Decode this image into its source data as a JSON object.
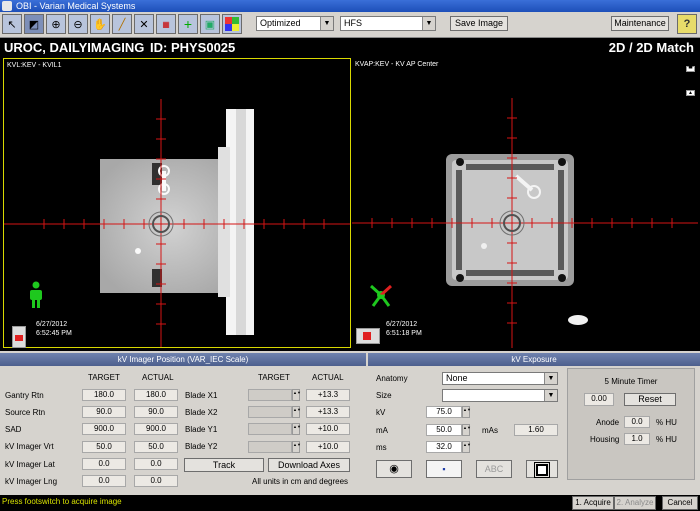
{
  "window": {
    "title": "OBI - Varian Medical Systems"
  },
  "toolbar": {
    "tools": [
      "select-tool",
      "window-level-tool",
      "zoom-in-tool",
      "zoom-out-tool",
      "pan-tool",
      "measure-tool",
      "match-tool",
      "spyglass-tool",
      "add-marker-tool",
      "blend-tool",
      "color-tool"
    ],
    "view_mode": "Optimized",
    "orientation": "HFS",
    "save_image_label": "Save Image",
    "maintenance_label": "Maintenance",
    "help_label": "?"
  },
  "header": {
    "patient": "UROC, DAILYIMAGING",
    "id_label": "ID: PHYS0025",
    "mode": "2D / 2D Match"
  },
  "viewers": {
    "left": {
      "label": "KVL:KEV - KVIL1",
      "date": "6/27/2012",
      "time": "6:52:45 PM"
    },
    "right": {
      "label": "KVAP:KEV - KV AP Center",
      "date": "6/27/2012",
      "time": "6:51:18 PM"
    }
  },
  "imager": {
    "title": "kV Imager Position (VAR_IEC Scale)",
    "target_label": "TARGET",
    "actual_label": "ACTUAL",
    "rows": [
      {
        "label": "Gantry Rtn",
        "target": "180.0",
        "actual": "180.0"
      },
      {
        "label": "Source Rtn",
        "target": "90.0",
        "actual": "90.0"
      },
      {
        "label": "SAD",
        "target": "900.0",
        "actual": "900.0"
      },
      {
        "label": "kV Imager Vrt",
        "target": "50.0",
        "actual": "50.0"
      },
      {
        "label": "kV Imager Lat",
        "target": "0.0",
        "actual": "0.0"
      },
      {
        "label": "kV Imager Lng",
        "target": "0.0",
        "actual": "0.0"
      }
    ],
    "blades": [
      {
        "label": "Blade X1",
        "target": "",
        "actual": "+13.3"
      },
      {
        "label": "Blade X2",
        "target": "",
        "actual": "+13.3"
      },
      {
        "label": "Blade Y1",
        "target": "",
        "actual": "+10.0"
      },
      {
        "label": "Blade Y2",
        "target": "",
        "actual": "+10.0"
      }
    ],
    "track_label": "Track",
    "download_label": "Download Axes",
    "units_note": "All units in cm and degrees"
  },
  "exposure": {
    "title": "kV Exposure",
    "anatomy_label": "Anatomy",
    "anatomy_value": "None",
    "size_label": "Size",
    "size_value": "",
    "kv_label": "kV",
    "kv_value": "75.0",
    "ma_label": "mA",
    "ma_value": "50.0",
    "mas_label": "mAs",
    "mas_value": "1.60",
    "ms_label": "ms",
    "ms_value": "32.0",
    "abc_label": "ABC"
  },
  "timer": {
    "title": "5 Minute Timer",
    "value": "0.00",
    "reset_label": "Reset",
    "anode_label": "Anode",
    "anode_value": "0.0",
    "housing_label": "Housing",
    "housing_value": "1.0",
    "unit": "% HU"
  },
  "footer": {
    "status": "Press footswitch to acquire image",
    "acquire_label": "1. Acquire",
    "analyze_label": "2. Analyze",
    "cancel_label": "Cancel"
  },
  "colors": {
    "crosshair": "#d31414",
    "active_border": "#d9d900",
    "status_text": "#d8e200",
    "panel_header": "#5a6c98"
  }
}
